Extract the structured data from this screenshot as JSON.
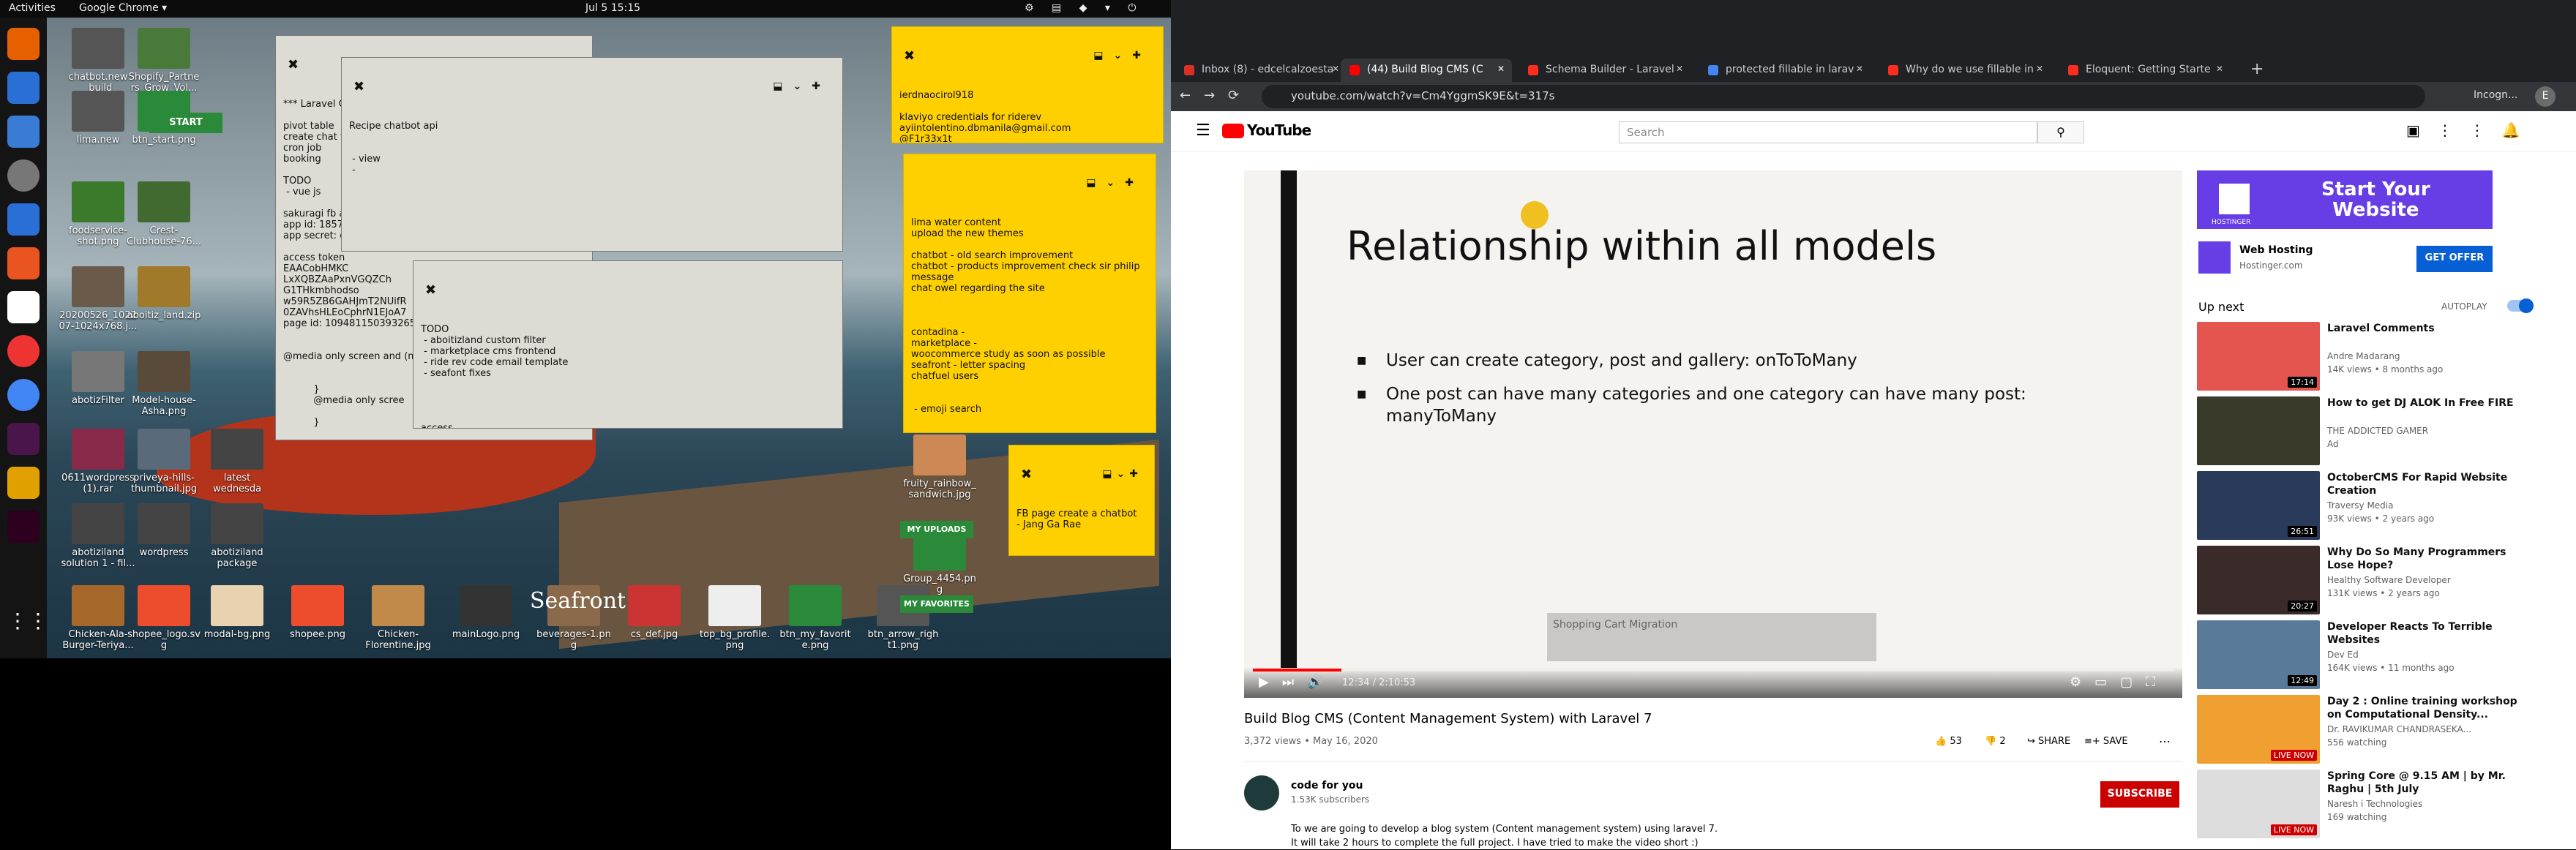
{
  "topbar": {
    "activities": "Activities",
    "app": "Google Chrome ▾",
    "clock": "Jul 5  15:15"
  },
  "desktop_icons": [
    {
      "label": "chatbot.new\n_build",
      "color": "#555"
    },
    {
      "label": "Shopify_Partne\nrs_Grow_Vol...",
      "color": "#4a7a3a"
    },
    {
      "label": "lima.new",
      "color": "#555"
    },
    {
      "label": "btn_start.png",
      "color": "#2a8a3a"
    },
    {
      "label": "foodservice-\nshot.png",
      "color": "#3a7a2a"
    },
    {
      "label": "Crest-\nClubhouse-76...",
      "color": "#406a30"
    },
    {
      "label": "20200526_1022\n07-1024x768.j...",
      "color": "#6a5a4a"
    },
    {
      "label": "aboitiz_land.zip",
      "color": "#a07a2a"
    },
    {
      "label": "abotizFilter",
      "color": "#777"
    },
    {
      "label": "Model-house-\nAsha.png",
      "color": "#5a4a3a"
    },
    {
      "label": "0611wordpress\n(1).rar",
      "color": "#8a2a4a"
    },
    {
      "label": "priveya-hills-\nthumbnail.jpg",
      "color": "#5a6a7a"
    },
    {
      "label": "latest\nwednesda",
      "color": "#444"
    },
    {
      "label": "abotiziland\nsolution 1 - fil...",
      "color": "#444"
    },
    {
      "label": "wordpress",
      "color": "#444"
    },
    {
      "label": "abotiziland\npackage",
      "color": "#444"
    },
    {
      "label": "Chicken-Ala-\nBurger-Teriya...",
      "color": "#a5682a"
    },
    {
      "label": "shopee_logo.sv\ng",
      "color": "#ee4d2d"
    },
    {
      "label": "modal-bg.png",
      "color": "#e8d2b0"
    },
    {
      "label": "shopee.png",
      "color": "#ee4d2d"
    },
    {
      "label": "Chicken-\nFlorentine.jpg",
      "color": "#c28a4a"
    },
    {
      "label": "mainLogo.png",
      "color": "#333"
    },
    {
      "label": "beverages-1.pn\ng",
      "color": "#8a6a4a"
    },
    {
      "label": "cs_def.jpg",
      "color": "#c33"
    },
    {
      "label": "top_bg_profile.\npng",
      "color": "#eee"
    },
    {
      "label": "btn_my_favorit\ne.png",
      "color": "#2a8a3a"
    },
    {
      "label": "btn_arrow_righ\nt1.png",
      "color": "#555"
    },
    {
      "label": "fruity_rainbow_\nsandwich.jpg",
      "color": "#c85"
    },
    {
      "label": "Group_4454.pn\ng",
      "color": "#2a8a3a"
    },
    {
      "label": "latest\nwednesda",
      "color": "#444"
    }
  ],
  "desktop_buttons": {
    "start": "START",
    "my_uploads": "MY UPLOADS",
    "my_favorites": "MY FAVORITES",
    "seafront": "Seafront"
  },
  "notes": {
    "n1": "*** Laravel C\n\npivot table\ncreate chat f\ncron job\nbooking\n\nTODO\n - vue js\n\nsakuragi fb a\napp id: 18572\napp secret: d\n\naccess token\nEAACobHMKC\nLxXQBZAaPxnVGQZCh\nG1THkmbhodso\nw59R5ZB6GAHJmT2NUifR\n0ZAVhsHLEoCphrN1EJoA7\npage id: 109481150393265\n\n\n@media only screen and (m\n\n\n          }\n          @media only scree\n\n          }",
    "n2": "Recipe chatbot api\n\n\n - view\n -",
    "n3": "TODO\n - aboitizland custom filter\n - marketplace cms frontend\n - ride rev code email template\n - seafont fixes\n\n\n\n\naccess\n ftp  / ssh",
    "n4": "ierdnaocirol918\n\nklaviyo credentials for riderev\nayiintolentino.dbmanila@gmail.com\n@F1r33x1t",
    "n5": "lima water content\nupload the new themes\n\nchatbot - old search improvement\nchatbot - products improvement check sir philip\nmessage\nchat owel regarding the site\n\n\n\ncontadina -\nmarketplace -\nwoocommerce study as soon as possible\nseafront - letter spacing\nchatfuel users\n\n\n - emoji search",
    "n6": "FB page create a chatbot\n- Jang Ga Rae"
  },
  "browser": {
    "tabs": [
      {
        "label": "Inbox (8) - edcelcalzoesta",
        "color": "#d93025"
      },
      {
        "label": "(44) Build Blog CMS (C",
        "color": "#ff0000"
      },
      {
        "label": "Schema Builder - Laravel",
        "color": "#ff2d20"
      },
      {
        "label": "protected fillable in larav",
        "color": "#4285f4"
      },
      {
        "label": "Why do we use fillable in",
        "color": "#ff2d20"
      },
      {
        "label": "Eloquent: Getting Starte",
        "color": "#ff2d20"
      }
    ],
    "url": "youtube.com/watch?v=Cm4YggmSK9E&t=317s",
    "incognito": "Incogn..."
  },
  "youtube": {
    "logo": "YouTube",
    "search_placeholder": "Search",
    "slide_title": "Relationship within all models",
    "bullets": [
      "User can create category, post and gallery: onToToMany",
      "One post can have many categories and one category can have many post:\nmanyToMany"
    ],
    "overlay_card": "Shopping Cart Migration",
    "time": "12:34 / 2:10:53",
    "video_title": "Build Blog CMS (Content Management System) with Laravel 7",
    "views_date": "3,372 views • May 16, 2020",
    "likes": "53",
    "dislikes": "2",
    "share": "SHARE",
    "save": "SAVE",
    "channel": "code for you",
    "subscribers": "1.53K subscribers",
    "subscribe": "SUBSCRIBE",
    "description": "To we are going to develop a blog system (Content management system) using laravel 7.\nIt will take 2 hours to complete the full project. I have tried to make the video short :)",
    "ad_headline": "Start Your\nWebsite",
    "ad_brand": "HOSTINGER",
    "ad_title": "Web Hosting",
    "ad_url": "Hostinger.com",
    "ad_cta": "GET OFFER",
    "up_next": "Up next",
    "autoplay": "AUTOPLAY",
    "related": [
      {
        "title": "Laravel Comments",
        "channel": "Andre Madarang",
        "meta": "14K views • 8 months ago",
        "duration": "17:14",
        "color": "#e5554f"
      },
      {
        "title": "How to get DJ ALOK In Free FIRE",
        "channel": "THE ADDICTED GAMER",
        "meta": "Ad",
        "duration": "",
        "color": "#3a3a2a"
      },
      {
        "title": "OctoberCMS For Rapid Website Creation",
        "channel": "Traversy Media",
        "meta": "93K views • 2 years ago",
        "duration": "26:51",
        "color": "#2a3a5a"
      },
      {
        "title": "Why Do So Many Programmers Lose Hope?",
        "channel": "Healthy Software Developer",
        "meta": "131K views • 2 years ago",
        "duration": "20:27",
        "color": "#3a2a2a"
      },
      {
        "title": "Developer Reacts To Terrible Websites",
        "channel": "Dev Ed",
        "meta": "164K views • 11 months ago",
        "duration": "12:49",
        "color": "#5a7a9a"
      },
      {
        "title": "Day 2 : Online training workshop on Computational Density...",
        "channel": "Dr. RAVIKUMAR CHANDRASEKA...",
        "meta": "556 watching",
        "duration": "LIVE NOW",
        "color": "#f0a030"
      },
      {
        "title": "Spring Core @ 9.15 AM | by Mr. Raghu | 5th July",
        "channel": "Naresh i Technologies",
        "meta": "169 watching",
        "duration": "LIVE NOW",
        "color": "#ddd"
      }
    ]
  }
}
